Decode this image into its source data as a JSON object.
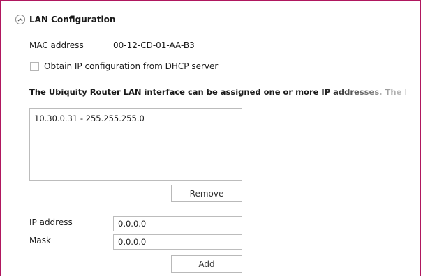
{
  "section": {
    "title": "LAN Configuration",
    "collapse_icon": "chevron-up-icon"
  },
  "mac": {
    "label": "MAC address",
    "value": "00-12-CD-01-AA-B3"
  },
  "dhcp": {
    "label": "Obtain IP configuration from DHCP server",
    "checked": false
  },
  "info_text": "The Ubiquity Router LAN interface can be assigned one or more IP addresses. The Router",
  "ip_list": {
    "items": [
      "10.30.0.31 - 255.255.255.0"
    ]
  },
  "buttons": {
    "remove_label": "Remove",
    "add_label": "Add"
  },
  "fields": {
    "ip_label": "IP address",
    "ip_value": "0.0.0.0",
    "mask_label": "Mask",
    "mask_value": "0.0.0.0"
  },
  "colors": {
    "frame_border": "#b0175f"
  }
}
